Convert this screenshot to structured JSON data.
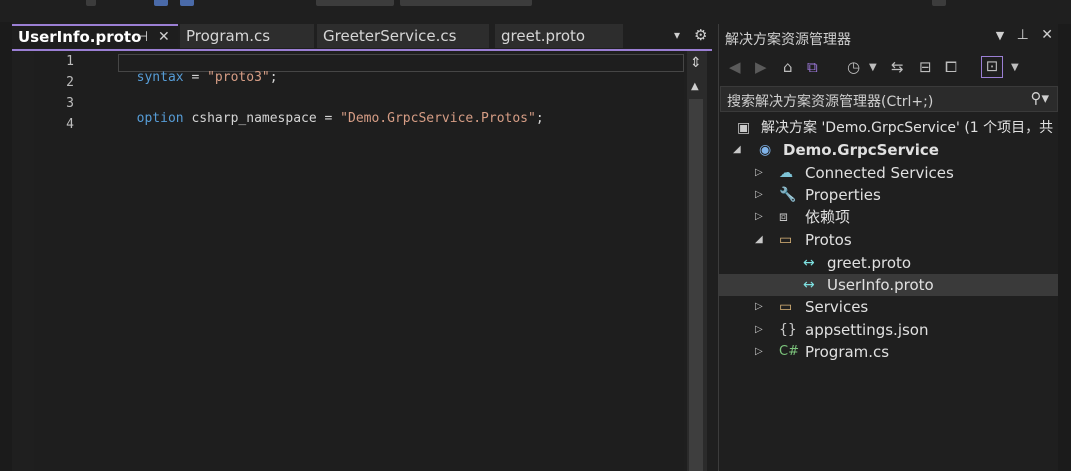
{
  "tabs": [
    {
      "label": "UserInfo.proto",
      "active": true
    },
    {
      "label": "Program.cs",
      "active": false
    },
    {
      "label": "GreeterService.cs",
      "active": false
    },
    {
      "label": "greet.proto",
      "active": false
    }
  ],
  "editor": {
    "lines": [
      {
        "number": "1",
        "tokens": [
          {
            "t": "syntax",
            "c": "kw"
          },
          {
            "t": " = ",
            "c": "plain"
          },
          {
            "t": "\"proto3\"",
            "c": "str"
          },
          {
            "t": ";",
            "c": "plain"
          }
        ]
      },
      {
        "number": "2",
        "tokens": []
      },
      {
        "number": "3",
        "tokens": [
          {
            "t": "option",
            "c": "kw"
          },
          {
            "t": " csharp_namespace = ",
            "c": "plain"
          },
          {
            "t": "\"Demo.GrpcService.Protos\"",
            "c": "str"
          },
          {
            "t": ";",
            "c": "plain"
          }
        ]
      },
      {
        "number": "4",
        "tokens": []
      }
    ]
  },
  "solution_explorer": {
    "title": "解决方案资源管理器",
    "search_placeholder": "搜索解决方案资源管理器(Ctrl+;)",
    "solution_label": "解决方案 'Demo.GrpcService' (1 个项目，共 1",
    "project_label": "Demo.GrpcService",
    "items": [
      {
        "label": "Connected Services",
        "icon": "connected-services-icon"
      },
      {
        "label": "Properties",
        "icon": "properties-icon"
      },
      {
        "label": "依赖项",
        "icon": "dependencies-icon"
      },
      {
        "label": "Protos",
        "icon": "folder-icon"
      },
      {
        "label": "greet.proto",
        "icon": "proto-file-icon"
      },
      {
        "label": "UserInfo.proto",
        "icon": "proto-file-icon",
        "selected": true
      },
      {
        "label": "Services",
        "icon": "folder-icon"
      },
      {
        "label": "appsettings.json",
        "icon": "json-file-icon"
      },
      {
        "label": "Program.cs",
        "icon": "csharp-file-icon"
      }
    ]
  },
  "colors": {
    "accent": "#9b7fd4",
    "keyword": "#569cd6",
    "string": "#d69d85"
  }
}
